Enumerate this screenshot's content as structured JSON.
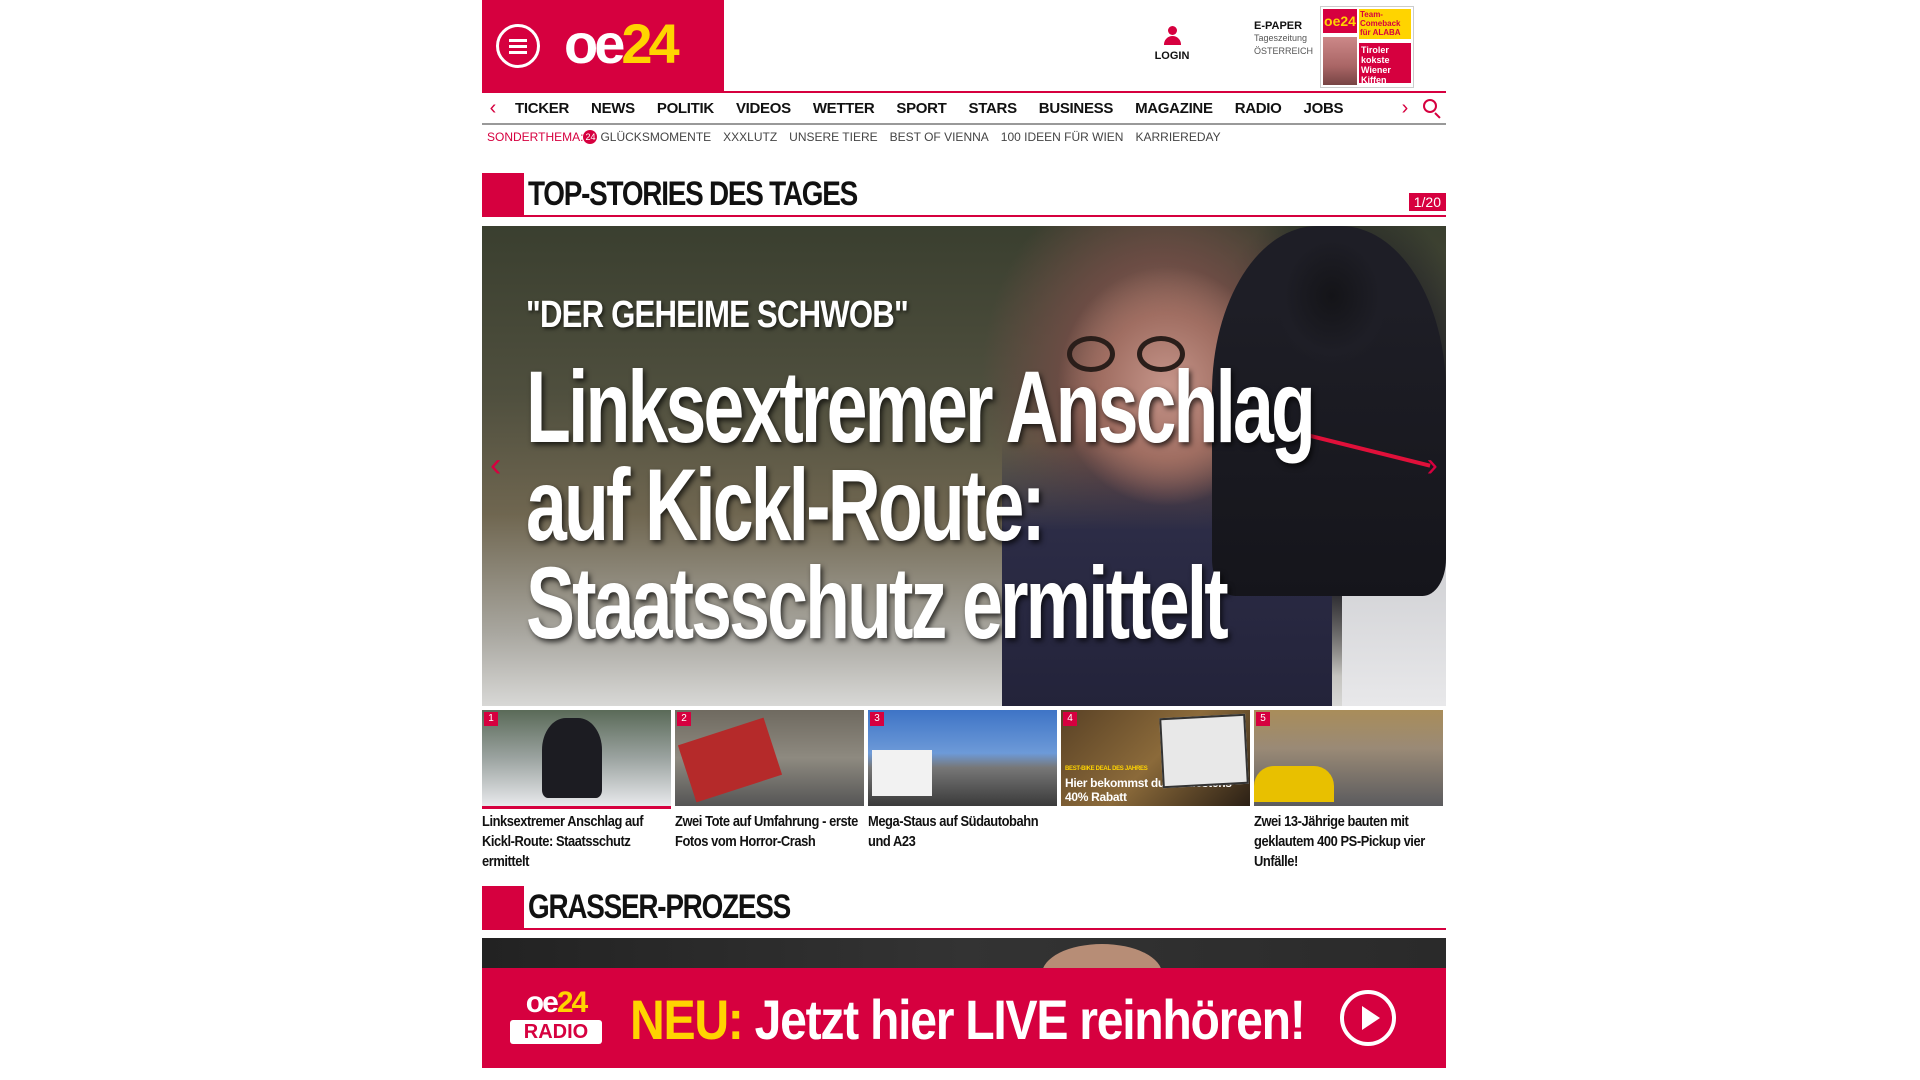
{
  "header": {
    "logo_oe": "oe",
    "logo_24": "24",
    "login_label": "LOGIN",
    "epaper_title": "E-PAPER",
    "epaper_sub1": "Tageszeitung",
    "epaper_sub2": "ÖSTERREICH",
    "epaper_cover_logo": "oe24",
    "epaper_cover_hl1": "Team-Comeback für ALABA",
    "epaper_cover_hl2": "Tiroler kokste Wiener Kiffen"
  },
  "nav": {
    "items": [
      "TICKER",
      "NEWS",
      "POLITIK",
      "VIDEOS",
      "WETTER",
      "SPORT",
      "STARS",
      "BUSINESS",
      "MAGAZINE",
      "RADIO",
      "JOBS"
    ],
    "left_arrow": "‹",
    "right_arrow": "›"
  },
  "subnav": {
    "label": "SONDERTHEMA:",
    "badge": "24",
    "items": [
      "GLÜCKSMOMENTE",
      "XXXLUTZ",
      "UNSERE TIERE",
      "BEST OF VIENNA",
      "100 IDEEN FÜR WIEN",
      "KARRIEREDAY"
    ]
  },
  "top_stories": {
    "title": "TOP-STORIES DES TAGES",
    "counter": "1/20",
    "hero_overline": "\"DER GEHEIME SCHWOB\"",
    "hero_headline": "Linksextremer Anschlag auf Kickl-Route: Staatsschutz ermittelt",
    "hero_prev": "‹",
    "hero_next": "›"
  },
  "thumbs": [
    {
      "num": "1",
      "title": "Linksextremer Anschlag auf Kickl-Route: Staatsschutz ermittelt"
    },
    {
      "num": "2",
      "title": "Zwei Tote auf Umfahrung - erste Fotos vom Horror-Crash"
    },
    {
      "num": "3",
      "title": "Mega-Staus auf Südautobahn und A23"
    },
    {
      "num": "4",
      "title": "",
      "promo_small": "BEST-BIKE DEAL DES JAHRES",
      "promo": "Hier bekommst du mindestens 40% Rabatt"
    },
    {
      "num": "5",
      "title": "Zwei 13-Jährige bauten mit geklautem 400 PS-Pickup vier Unfälle!"
    }
  ],
  "section2": {
    "title": "GRASSER-PROZESS"
  },
  "radio_banner": {
    "logo_oe": "oe",
    "logo_24": "24",
    "logo_radio": "RADIO",
    "msg_new": "NEU:",
    "msg_rest": " Jetzt hier LIVE reinhören!"
  }
}
